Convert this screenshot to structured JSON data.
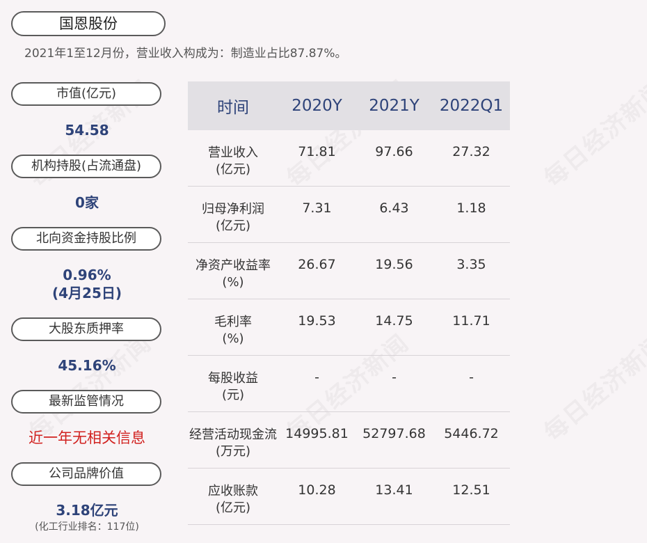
{
  "watermark": "每日经济新闻",
  "header": {
    "title": "国恩股份",
    "subtitle": "2021年1至12月份，营业收入构成为：制造业占比87.87%。"
  },
  "left_panel": {
    "market_cap": {
      "label": "市值(亿元)",
      "value": "54.58"
    },
    "institution": {
      "label": "机构持股(占流通盘)",
      "value": "0家"
    },
    "northbound": {
      "label": "北向资金持股比例",
      "value": "0.96%",
      "date": "(4月25日)"
    },
    "pledge": {
      "label": "大股东质押率",
      "value": "45.16%"
    },
    "regulation": {
      "label": "最新监管情况",
      "value": "近一年无相关信息"
    },
    "brand": {
      "label": "公司品牌价值",
      "value": "3.18亿元",
      "note": "(化工行业排名：117位)"
    }
  },
  "table": {
    "headers": [
      "时间",
      "2020Y",
      "2021Y",
      "2022Q1"
    ],
    "rows": [
      {
        "label": "营业收入",
        "unit": "(亿元)",
        "values": [
          "71.81",
          "97.66",
          "27.32"
        ]
      },
      {
        "label": "归母净利润",
        "unit": "(亿元)",
        "values": [
          "7.31",
          "6.43",
          "1.18"
        ]
      },
      {
        "label": "净资产收益率",
        "unit": "(%)",
        "values": [
          "26.67",
          "19.56",
          "3.35"
        ]
      },
      {
        "label": "毛利率",
        "unit": "(%)",
        "values": [
          "19.53",
          "14.75",
          "11.71"
        ]
      },
      {
        "label": "每股收益",
        "unit": "(元)",
        "values": [
          "-",
          "-",
          "-"
        ]
      },
      {
        "label": "经营活动现金流",
        "unit": "(万元)",
        "values": [
          "14995.81",
          "52797.68",
          "5446.72"
        ]
      },
      {
        "label": "应收账款",
        "unit": "(亿元)",
        "values": [
          "10.28",
          "13.41",
          "12.51"
        ]
      }
    ]
  },
  "colors": {
    "value_blue": "#2e4379",
    "alert_red": "#d1211f",
    "table_header_bg": "#e2e0e4",
    "background": "#f8f4f6"
  }
}
